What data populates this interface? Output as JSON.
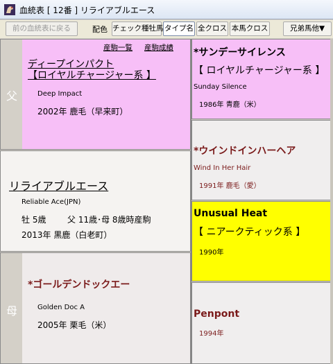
{
  "window": {
    "title": "血統表 [ 12番 ] リライアブルエース",
    "icon": "horse-icon"
  },
  "toolbar": {
    "back_label": "前の血統表に戻る",
    "color_label": "配色",
    "check_sire_label": "チェック種牡馬",
    "type_name_label": "タイプ名",
    "all_cross_label": "全クロス",
    "main_cross_label": "本馬クロス",
    "siblings_label": "兄弟馬他▼"
  },
  "sire": {
    "side_label": "父",
    "links": {
      "produce_list": "産駒一覧",
      "produce_record": "産駒成績"
    },
    "name": "ディープインパクト",
    "line": "【ロイヤルチャージャー系 】",
    "english": "Deep Impact",
    "birth": "2002年 鹿毛（早来町）",
    "bg": "#f7bff7"
  },
  "horse": {
    "name": "リライアブルエース",
    "english": "Reliable Ace(JPN)",
    "sex_age": "牡 5歳",
    "parents_age": "父 11歳･母 8歳時産駒",
    "birth": "2013年 黒鹿（白老町）",
    "bg": "#f5f3f1"
  },
  "dam": {
    "side_label": "母",
    "name": "*ゴールデンドックエー",
    "english": "Golden Doc A",
    "birth": "2005年 栗毛（米）",
    "bg": "#efebeb"
  },
  "ancestors": [
    {
      "name": "*サンデーサイレンス",
      "line": "【 ロイヤルチャージャー系 】",
      "english": "Sunday Silence",
      "birth": "1986年 青鹿（米）",
      "bg": "#f7bff7"
    },
    {
      "name": "*ウインドインハーヘア",
      "line": "",
      "english": "Wind In Her Hair",
      "birth": "1991年 鹿毛（愛）",
      "bg": "#f0eeee"
    },
    {
      "name": "Unusual Heat",
      "line": "【 ニアークティック系 】",
      "english": "",
      "birth": "1990年",
      "bg": "#ffff00"
    },
    {
      "name": "Penpont",
      "line": "",
      "english": "",
      "birth": "1994年",
      "bg": "#f0eeee"
    }
  ]
}
